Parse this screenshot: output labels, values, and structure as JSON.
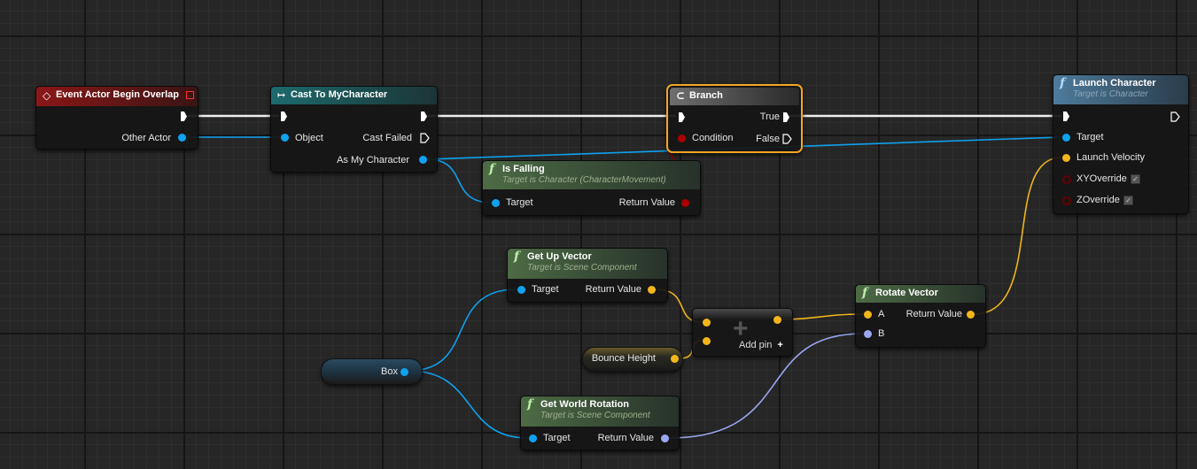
{
  "nodes": {
    "event_overlap": {
      "title": "Event Actor Begin Overlap",
      "icon": "event-diamond-icon",
      "pins": {
        "other_actor": "Other Actor"
      }
    },
    "cast": {
      "title": "Cast To MyCharacter",
      "icon": "cast-arrow-icon",
      "pins": {
        "object": "Object",
        "cast_failed": "Cast Failed",
        "as_my_character": "As My Character"
      }
    },
    "branch": {
      "title": "Branch",
      "icon": "branch-icon",
      "pins": {
        "condition": "Condition",
        "true": "True",
        "false": "False"
      }
    },
    "launch": {
      "title": "Launch Character",
      "subtitle": "Target is Character",
      "icon": "function-icon",
      "pins": {
        "target": "Target",
        "launch_velocity": "Launch Velocity",
        "xy_override": "XYOverride",
        "z_override": "ZOverride"
      },
      "xy_override_checked": true,
      "z_override_checked": true
    },
    "is_falling": {
      "title": "Is Falling",
      "subtitle": "Target is Character (CharacterMovement)",
      "icon": "function-icon",
      "pins": {
        "target": "Target",
        "return_value": "Return Value"
      }
    },
    "get_up_vector": {
      "title": "Get Up Vector",
      "subtitle": "Target is Scene Component",
      "icon": "function-icon",
      "pins": {
        "target": "Target",
        "return_value": "Return Value"
      }
    },
    "add": {
      "icon": "plus-icon",
      "add_pin": "Add pin"
    },
    "bounce_height": {
      "label": "Bounce Height"
    },
    "box": {
      "label": "Box"
    },
    "get_world_rotation": {
      "title": "Get World Rotation",
      "subtitle": "Target is Scene Component",
      "icon": "function-icon",
      "pins": {
        "target": "Target",
        "return_value": "Return Value"
      }
    },
    "rotate_vector": {
      "title": "Rotate Vector",
      "icon": "function-icon",
      "pins": {
        "a": "A",
        "b": "B",
        "return_value": "Return Value"
      }
    }
  },
  "colors": {
    "exec": "#ffffff",
    "object": "#0ea2f0",
    "vector": "#f2b61b",
    "bool": "#a00000",
    "rotator": "#9aa7f0",
    "selected": "#f5a623"
  }
}
